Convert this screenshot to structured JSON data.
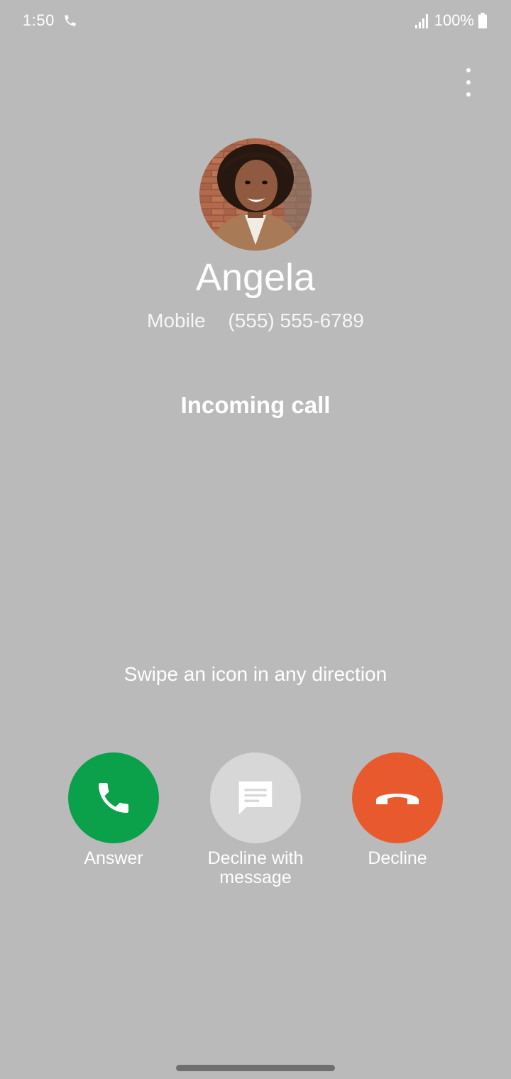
{
  "status_bar": {
    "time": "1:50",
    "battery": "100%"
  },
  "caller": {
    "name": "Angela",
    "number_type": "Mobile",
    "number": "(555) 555-6789"
  },
  "call_status": "Incoming call",
  "swipe_hint": "Swipe an icon in any direction",
  "actions": {
    "answer": {
      "label": "Answer",
      "color": "#0aa14a",
      "icon": "phone-icon"
    },
    "message": {
      "label_line1": "Decline with",
      "label_line2": "message",
      "color": "#d7d7d7",
      "icon": "message-icon"
    },
    "decline": {
      "label": "Decline",
      "color": "#e85a2e",
      "icon": "hang-up-icon"
    }
  }
}
